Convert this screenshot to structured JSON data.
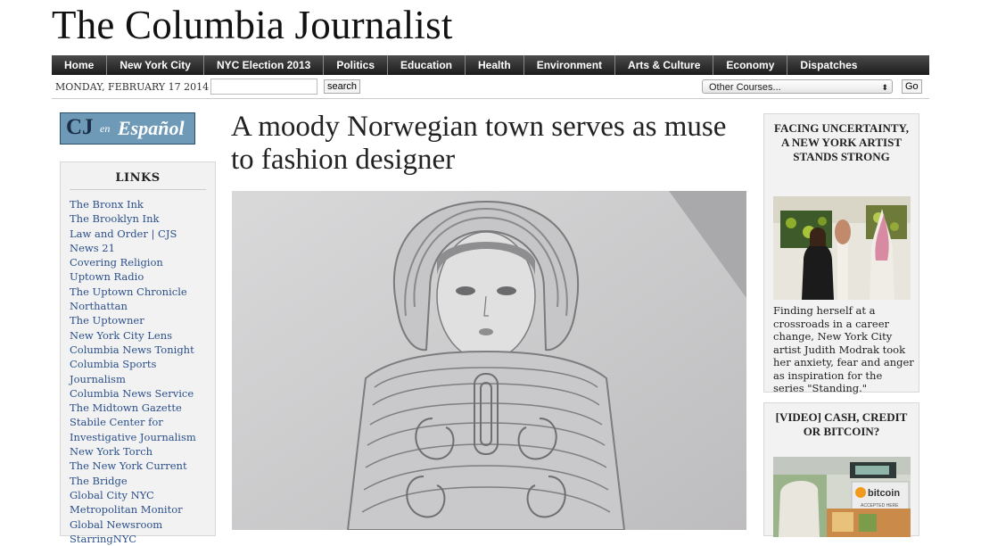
{
  "site": {
    "title": "The Columbia Journalist"
  },
  "nav": {
    "items": [
      "Home",
      "New York City",
      "NYC Election 2013",
      "Politics",
      "Education",
      "Health",
      "Environment",
      "Arts & Culture",
      "Economy",
      "Dispatches"
    ]
  },
  "datebar": {
    "date": "MONDAY, FEBRUARY 17 2014",
    "search_value": "",
    "search_button": "search",
    "courses_selected": "Other Courses...",
    "go_button": "Go"
  },
  "espanol": {
    "cj": "CJ",
    "en": "en",
    "espanol": "Español"
  },
  "links": {
    "title": "LINKS",
    "items": [
      "The Bronx Ink",
      "The Brooklyn Ink",
      "Law and Order | CJS",
      "News 21",
      "Covering Religion",
      "Uptown Radio",
      "The Uptown Chronicle",
      "Northattan",
      "The Uptowner",
      "New York City Lens",
      "Columbia News Tonight",
      "Columbia Sports Journalism",
      "Columbia News Service",
      "The Midtown Gazette",
      "Stabile Center for",
      "Investigative Journalism",
      "New York Torch",
      "The New York Current",
      "The Bridge",
      "Global City NYC",
      "Metropolitan Monitor",
      "Global Newsroom",
      "StarringNYC"
    ]
  },
  "article": {
    "headline": "A moody Norwegian town serves as muse to fashion designer"
  },
  "sidebar": {
    "feature1": {
      "title": "FACING UNCERTAINTY, A NEW YORK ARTIST STANDS STRONG",
      "text": "Finding herself at a crossroads in a career change, New York City artist Judith Modrak took her anxiety, fear and anger as inspiration for the series \"Standing.\""
    },
    "feature2": {
      "title": "[VIDEO] CASH, CREDIT OR BITCOIN?",
      "image_text": "bitcoin",
      "image_subtext": "ACCEPTED HERE"
    }
  }
}
